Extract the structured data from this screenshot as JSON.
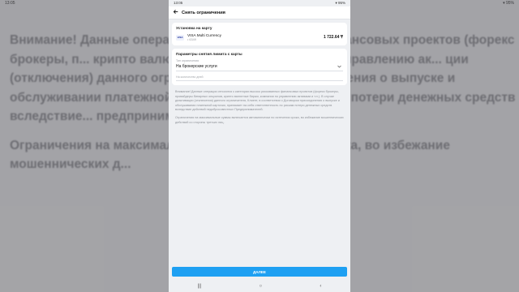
{
  "status_bar": {
    "time": "13:05",
    "right": "▾ 95%"
  },
  "backdrop": {
    "p1": "Внимание! Данные операции отн... рискованных финансовых проектов (форекс брокеры, п... крипто валютные биржи, компании по управлению ак... ции (отключения) данного ограничителя, Клиент, в соот... ения о выпуске и обслуживании платежной ка... тственность по рискам потери денежных средств вследствие... предпринимателей.",
    "p2": "Ограничения на максимальн... ески по истечении срока, во избежание мошеннических д..."
  },
  "header": {
    "title": "Снять ограничения"
  },
  "card_section": {
    "title": "Установка на карту",
    "card_name": "VISA Multi Currency",
    "card_number": "• 6349",
    "balance": "1 722.64 ₸",
    "visa_logo": "VISA"
  },
  "params_section": {
    "title": "Параметры снятия лимита с карты",
    "type_label": "Тип ограничения",
    "type_value": "На брокерские услуги",
    "days_placeholder": "На количество дней"
  },
  "info": {
    "p1": "Внимание! Данные операции относятся к категории высоко рискованных финансовых проектов (форекс брокеры, провайдеры бинарных опционов, крипто валютные биржи, компании по управлению активами и т.п.). В случае деактивации (отключения) данного ограничителя, Клиент, в соответствии с Договором присоединения о выпуске и обслуживании платежной карточки, принимает на себя ответственность по рискам потери денежных средств вследствие действий недобросовестных Предпринимателей.",
    "p2": "Ограничения на максимальные суммы включается автоматически по истечении срока, во избежание мошеннических действий со стороны третьих лиц."
  },
  "button": {
    "label": "ДАЛЕЕ"
  },
  "nav": {
    "recent": "|||",
    "home": "○",
    "back": "‹"
  },
  "icons": {
    "back": "arrow-left-icon",
    "chevron": "chevron-down-icon"
  },
  "colors": {
    "accent": "#1ea0f2",
    "background": "#eef0f3"
  }
}
